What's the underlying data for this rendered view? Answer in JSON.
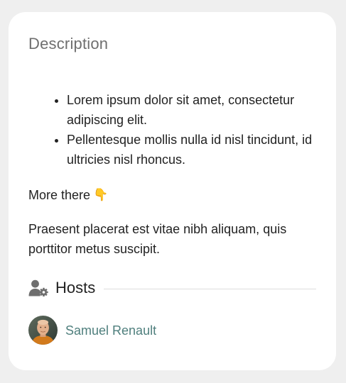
{
  "card": {
    "title": "Description"
  },
  "bullets": [
    "Lorem ipsum dolor sit amet, consectetur adipiscing elit.",
    "Pellentesque mollis nulla id nisl tincidunt, id ultricies nisl rhoncus."
  ],
  "more": {
    "text": "More there",
    "emoji": "👇"
  },
  "paragraph": "Praesent placerat est vitae nibh aliquam, quis porttitor metus suscipit.",
  "hosts": {
    "icon": "user-gear-icon",
    "title": "Hosts",
    "items": [
      {
        "name": "Samuel Renault",
        "avatar": "avatar-photo"
      }
    ]
  },
  "colors": {
    "background": "#efefef",
    "card": "#ffffff",
    "title": "#6f6f6f",
    "link": "#4f7f7d",
    "divider": "#dddddd"
  }
}
